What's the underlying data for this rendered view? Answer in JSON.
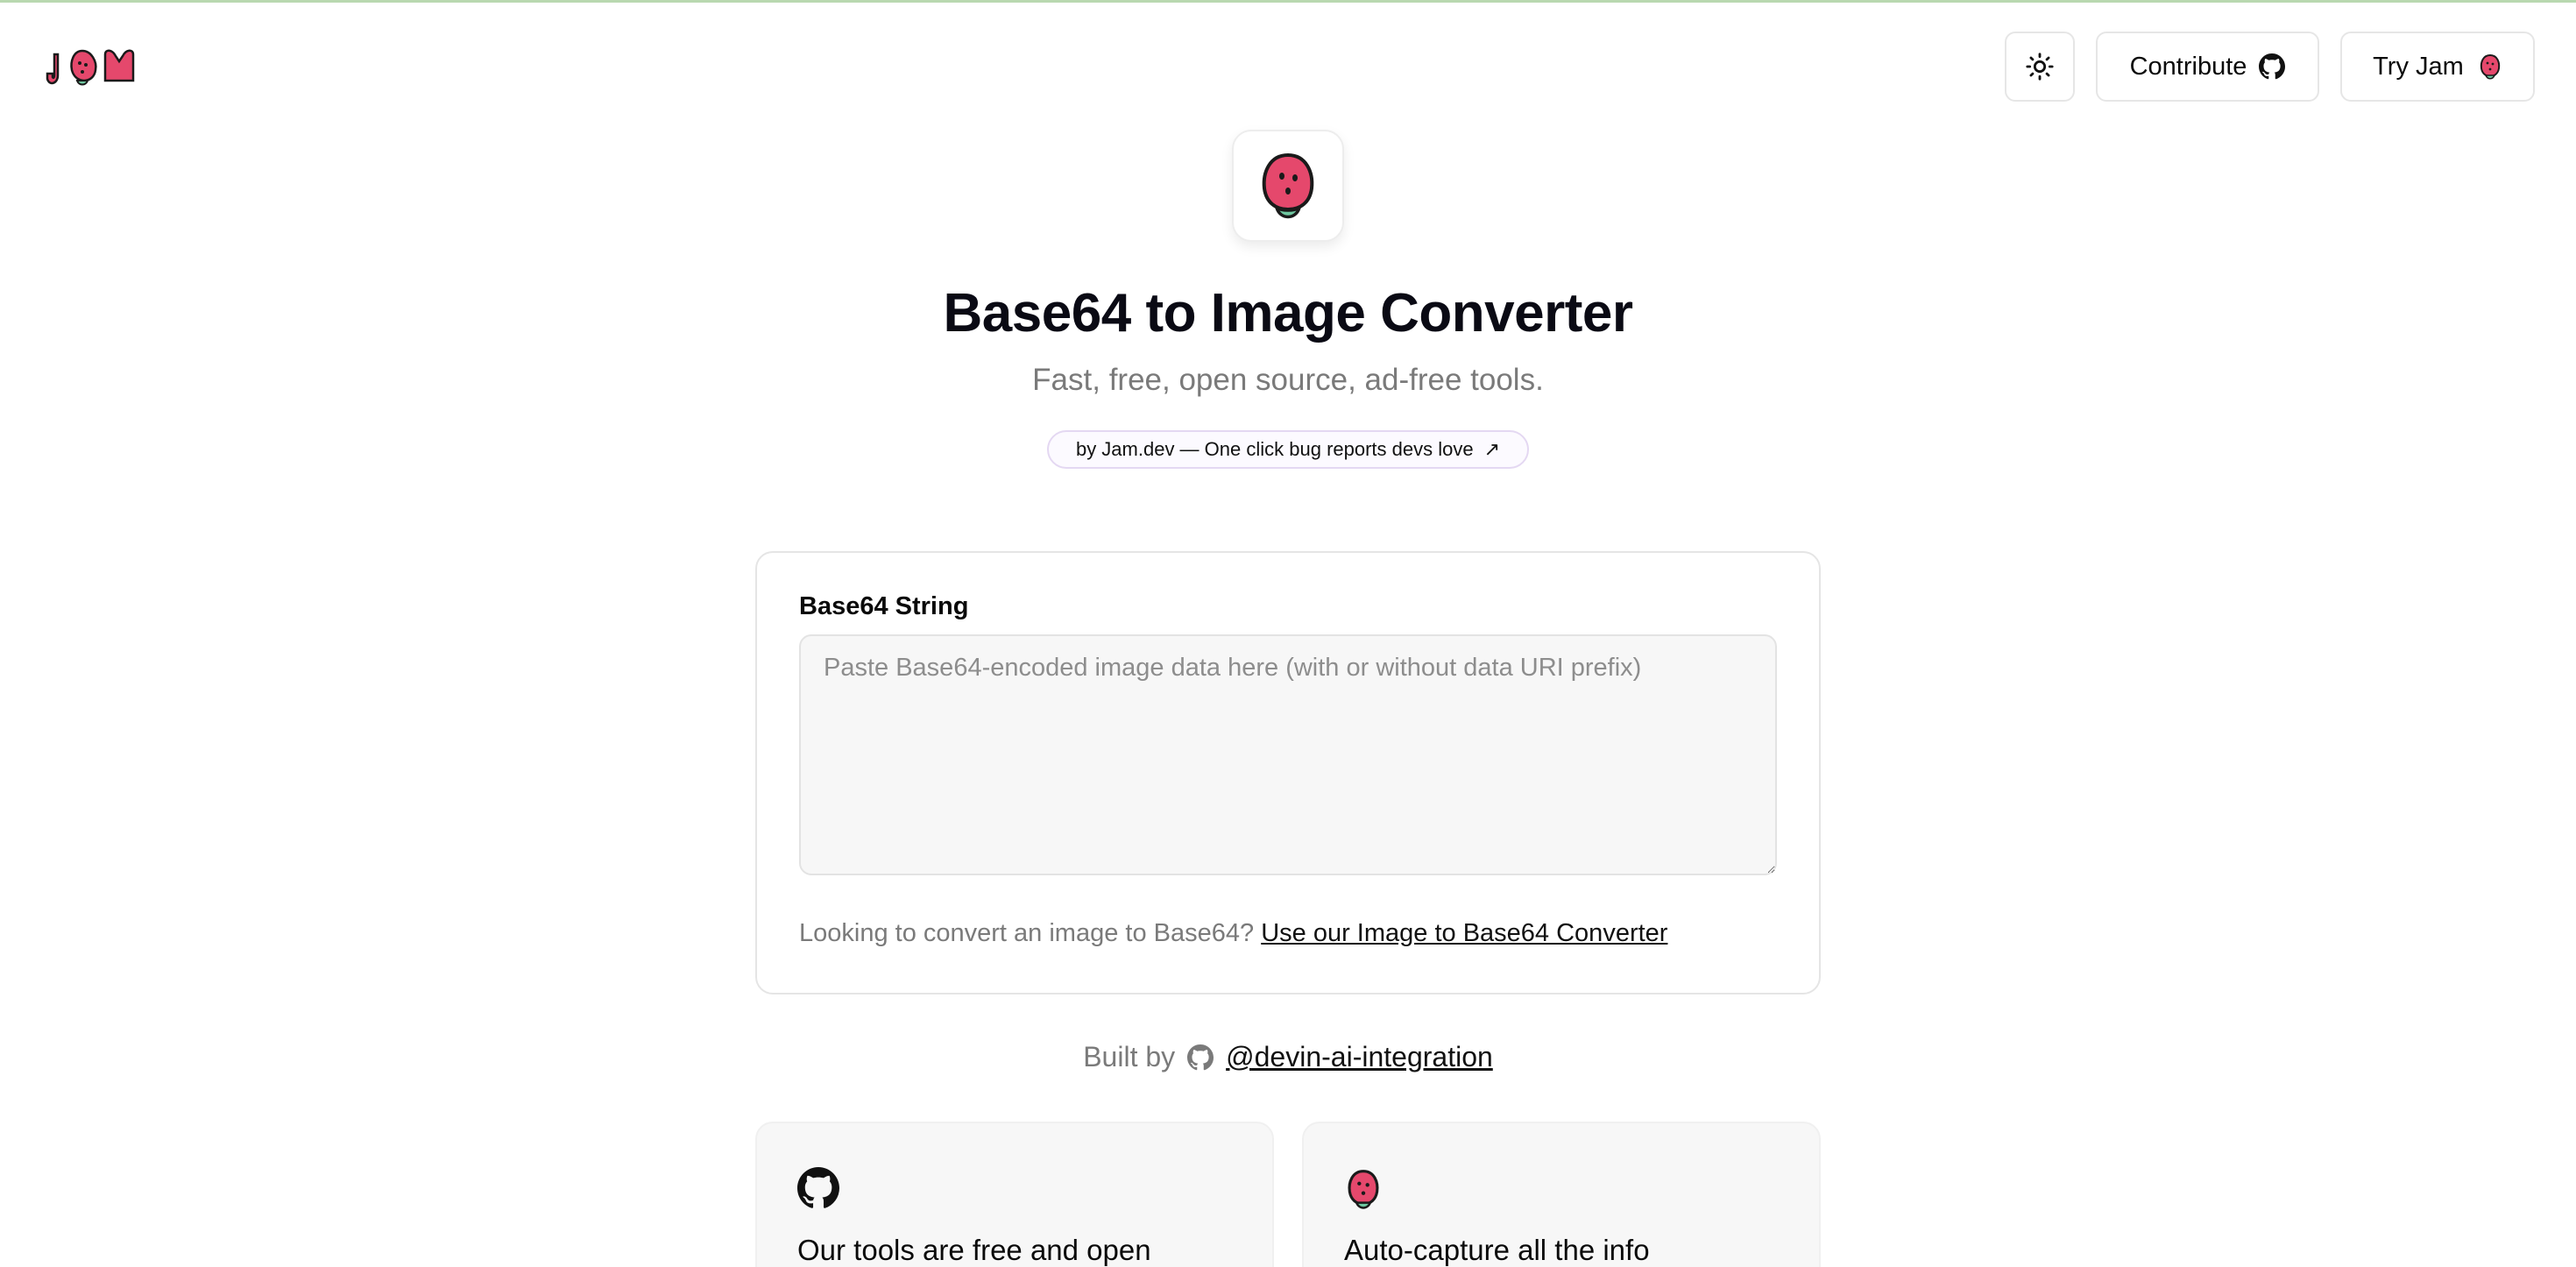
{
  "header": {
    "logo_text": "JAM",
    "theme_toggle": "sun-icon",
    "contribute_label": "Contribute",
    "try_label": "Try Jam"
  },
  "hero": {
    "title": "Base64 to Image Converter",
    "subtitle": "Fast, free, open source, ad-free tools.",
    "pill_label": "by Jam.dev — One click bug reports devs love",
    "pill_arrow": "↗"
  },
  "converter": {
    "label": "Base64 String",
    "placeholder": "Paste Base64-encoded image data here (with or without data URI prefix)",
    "value": "",
    "hint_text": "Looking to convert an image to Base64?",
    "hint_link": "Use our Image to Base64 Converter"
  },
  "footer": {
    "built_by_label": "Built by",
    "author": "@devin-ai-integration"
  },
  "features": [
    {
      "icon": "github-icon",
      "title": "Our tools are free and open"
    },
    {
      "icon": "strawberry-icon",
      "title": "Auto-capture all the info"
    }
  ],
  "colors": {
    "accent": "#e5486c",
    "leaf": "#6fc7a0",
    "border": "#e5e5e5",
    "muted_text": "#7a7a7a"
  }
}
